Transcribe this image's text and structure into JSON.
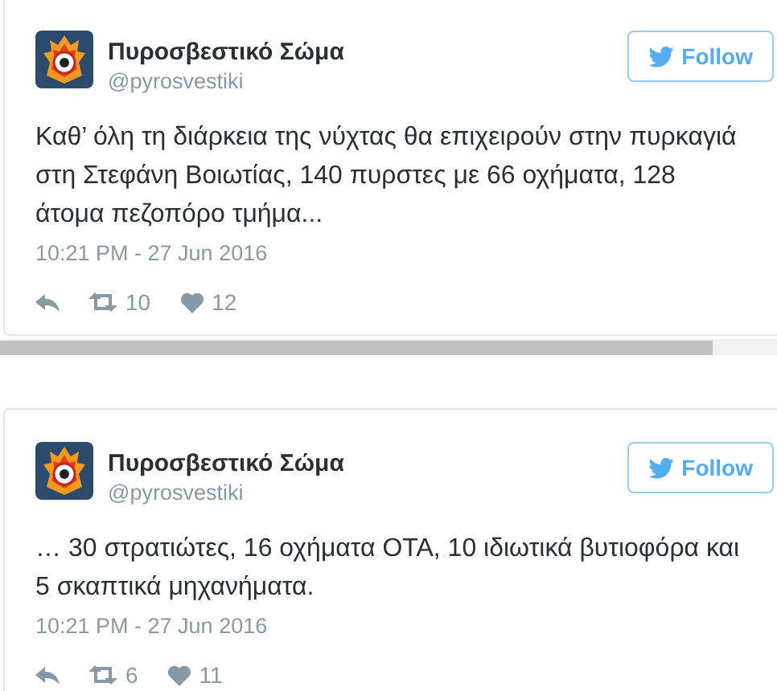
{
  "tweets": [
    {
      "name": "Πυροσβεστικό Σώμα",
      "handle": "@pyrosvestiki",
      "follow": "Follow",
      "text": "Καθ’ όλη τη διάρκεια της νύχτας θα επιχειρούν στην πυρκαγιά στη Στεφάνη Βοιωτίας, 140 πυρστες με 66 οχήματα, 128 άτομα πεζοπόρο τμήμα...",
      "time": "10:21 PM - 27 Jun 2016",
      "retweets": "10",
      "likes": "12"
    },
    {
      "name": "Πυροσβεστικό Σώμα",
      "handle": "@pyrosvestiki",
      "follow": "Follow",
      "text": "… 30 στρατιώτες, 16 οχήματα ΟΤΑ, 10 ιδιωτικά βυτιοφόρα και 5 σκαπτικά μηχανήματα.",
      "time": "10:21 PM - 27 Jun 2016",
      "retweets": "6",
      "likes": "11"
    }
  ]
}
